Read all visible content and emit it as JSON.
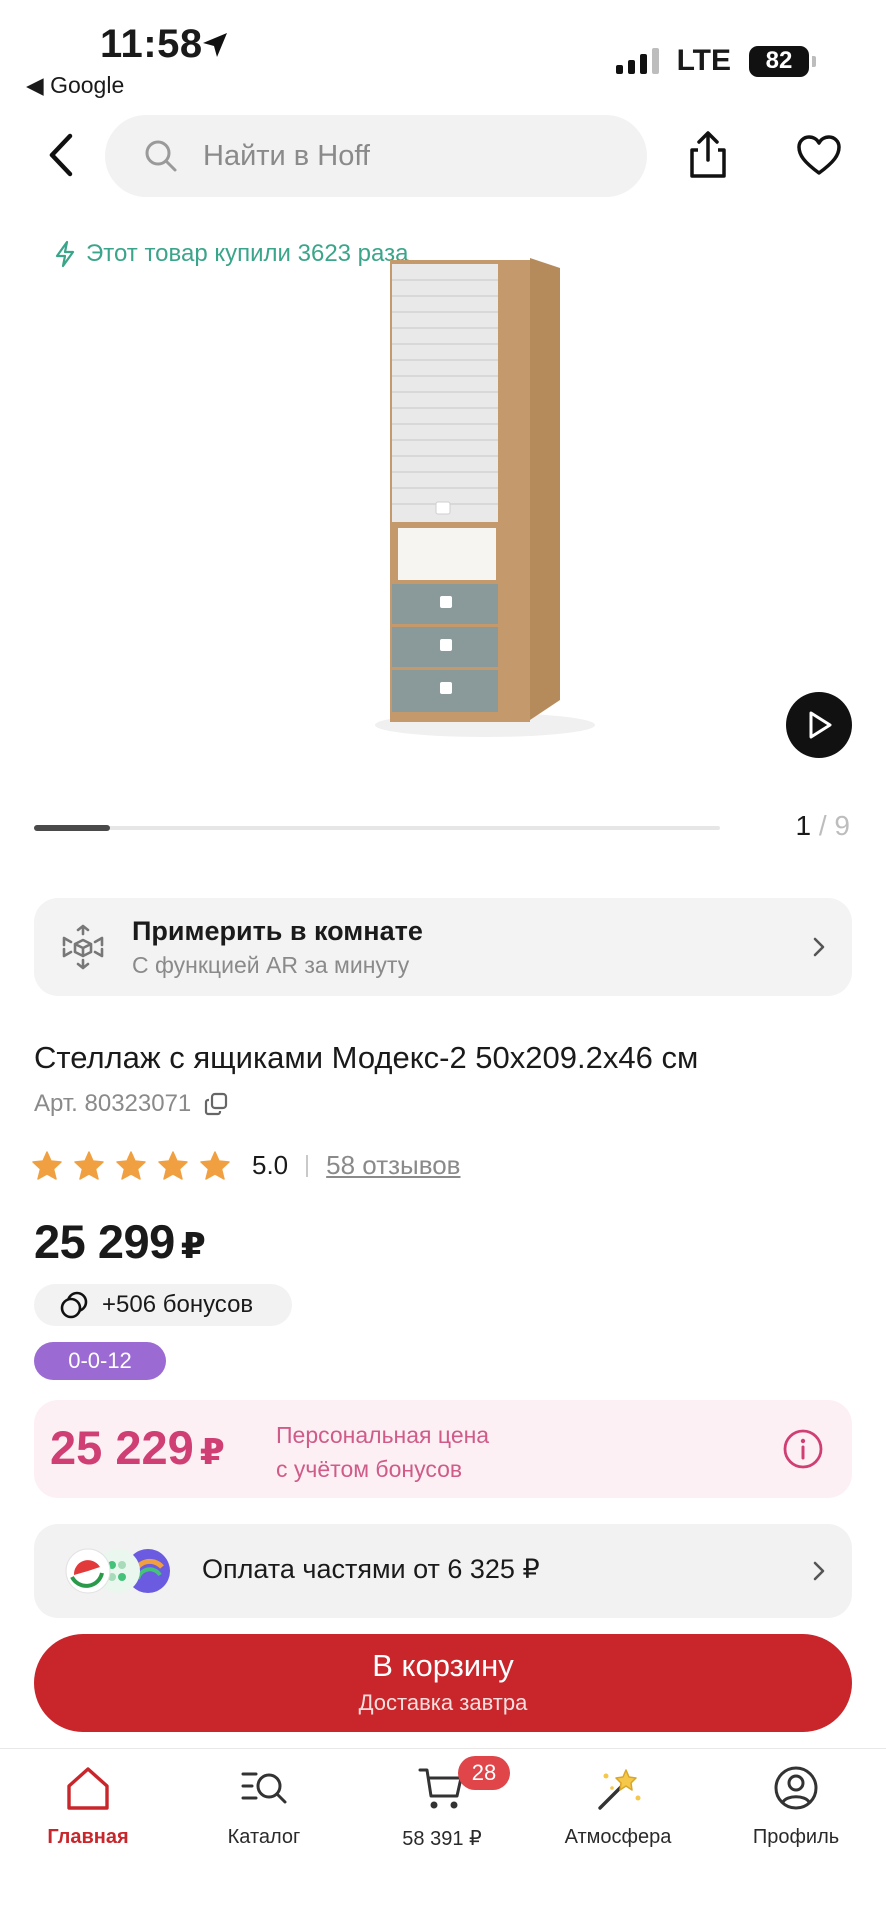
{
  "status_bar": {
    "time": "11:58",
    "back_app": "◀ Google",
    "network": "LTE",
    "battery": "82"
  },
  "header": {
    "search_placeholder": "Найти в Hoff"
  },
  "gallery": {
    "purchased_text": "Этот товар купили 3623 раза",
    "current": "1",
    "separator": "/",
    "total": "9",
    "progress_fraction": 0.111
  },
  "ar": {
    "title": "Примерить в комнате",
    "subtitle": "С функцией AR за минуту"
  },
  "product": {
    "title": "Стеллаж с ящиками Модекс-2 50x209.2x46 см",
    "article": "Арт. 80323071",
    "rating_value": "5.0",
    "stars": 5,
    "reviews": "58 отзывов",
    "price": "25 299",
    "currency": "₽",
    "bonus": "+506 бонусов",
    "installment_badge": "0-0-12"
  },
  "personal_price": {
    "price": "25 229",
    "currency": "₽",
    "line1": "Персональная цена",
    "line2": "с учётом бонусов"
  },
  "split_payment": {
    "text": "Оплата частями от 6 325 ₽"
  },
  "cart_button": {
    "label": "В корзину",
    "sub_label": "Доставка завтра"
  },
  "tabbar": {
    "home": "Главная",
    "catalog": "Каталог",
    "cart": "58 391 ₽",
    "cart_count": "28",
    "atmosphere": "Атмосфера",
    "profile": "Профиль"
  },
  "colors": {
    "brand_red": "#c8262b",
    "personal_pink": "#cf3f74",
    "accent_green": "#3aa58a",
    "badge_purple": "#9b6bd3",
    "star_orange": "#f0a040"
  }
}
